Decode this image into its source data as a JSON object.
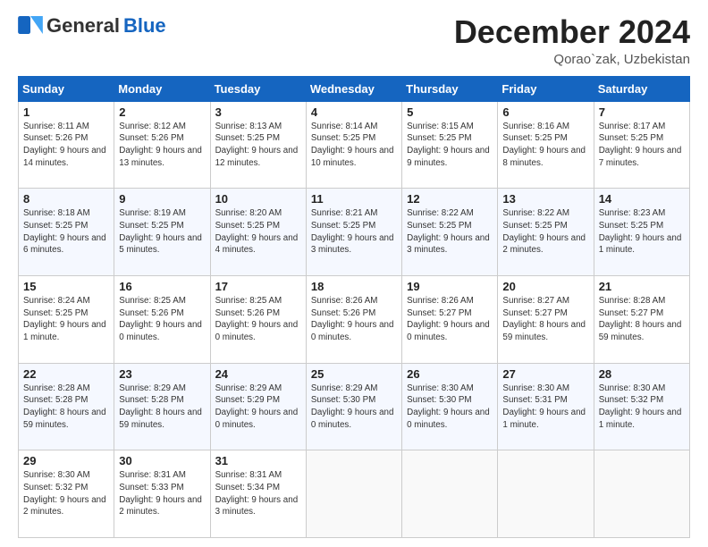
{
  "header": {
    "logo_general": "General",
    "logo_blue": "Blue",
    "month_title": "December 2024",
    "location": "Qorao`zak, Uzbekistan"
  },
  "weekdays": [
    "Sunday",
    "Monday",
    "Tuesday",
    "Wednesday",
    "Thursday",
    "Friday",
    "Saturday"
  ],
  "weeks": [
    [
      {
        "day": "1",
        "sunrise": "8:11 AM",
        "sunset": "5:26 PM",
        "daylight": "9 hours and 14 minutes."
      },
      {
        "day": "2",
        "sunrise": "8:12 AM",
        "sunset": "5:26 PM",
        "daylight": "9 hours and 13 minutes."
      },
      {
        "day": "3",
        "sunrise": "8:13 AM",
        "sunset": "5:25 PM",
        "daylight": "9 hours and 12 minutes."
      },
      {
        "day": "4",
        "sunrise": "8:14 AM",
        "sunset": "5:25 PM",
        "daylight": "9 hours and 10 minutes."
      },
      {
        "day": "5",
        "sunrise": "8:15 AM",
        "sunset": "5:25 PM",
        "daylight": "9 hours and 9 minutes."
      },
      {
        "day": "6",
        "sunrise": "8:16 AM",
        "sunset": "5:25 PM",
        "daylight": "9 hours and 8 minutes."
      },
      {
        "day": "7",
        "sunrise": "8:17 AM",
        "sunset": "5:25 PM",
        "daylight": "9 hours and 7 minutes."
      }
    ],
    [
      {
        "day": "8",
        "sunrise": "8:18 AM",
        "sunset": "5:25 PM",
        "daylight": "9 hours and 6 minutes."
      },
      {
        "day": "9",
        "sunrise": "8:19 AM",
        "sunset": "5:25 PM",
        "daylight": "9 hours and 5 minutes."
      },
      {
        "day": "10",
        "sunrise": "8:20 AM",
        "sunset": "5:25 PM",
        "daylight": "9 hours and 4 minutes."
      },
      {
        "day": "11",
        "sunrise": "8:21 AM",
        "sunset": "5:25 PM",
        "daylight": "9 hours and 3 minutes."
      },
      {
        "day": "12",
        "sunrise": "8:22 AM",
        "sunset": "5:25 PM",
        "daylight": "9 hours and 3 minutes."
      },
      {
        "day": "13",
        "sunrise": "8:22 AM",
        "sunset": "5:25 PM",
        "daylight": "9 hours and 2 minutes."
      },
      {
        "day": "14",
        "sunrise": "8:23 AM",
        "sunset": "5:25 PM",
        "daylight": "9 hours and 1 minute."
      }
    ],
    [
      {
        "day": "15",
        "sunrise": "8:24 AM",
        "sunset": "5:25 PM",
        "daylight": "9 hours and 1 minute."
      },
      {
        "day": "16",
        "sunrise": "8:25 AM",
        "sunset": "5:26 PM",
        "daylight": "9 hours and 0 minutes."
      },
      {
        "day": "17",
        "sunrise": "8:25 AM",
        "sunset": "5:26 PM",
        "daylight": "9 hours and 0 minutes."
      },
      {
        "day": "18",
        "sunrise": "8:26 AM",
        "sunset": "5:26 PM",
        "daylight": "9 hours and 0 minutes."
      },
      {
        "day": "19",
        "sunrise": "8:26 AM",
        "sunset": "5:27 PM",
        "daylight": "9 hours and 0 minutes."
      },
      {
        "day": "20",
        "sunrise": "8:27 AM",
        "sunset": "5:27 PM",
        "daylight": "8 hours and 59 minutes."
      },
      {
        "day": "21",
        "sunrise": "8:28 AM",
        "sunset": "5:27 PM",
        "daylight": "8 hours and 59 minutes."
      }
    ],
    [
      {
        "day": "22",
        "sunrise": "8:28 AM",
        "sunset": "5:28 PM",
        "daylight": "8 hours and 59 minutes."
      },
      {
        "day": "23",
        "sunrise": "8:29 AM",
        "sunset": "5:28 PM",
        "daylight": "8 hours and 59 minutes."
      },
      {
        "day": "24",
        "sunrise": "8:29 AM",
        "sunset": "5:29 PM",
        "daylight": "9 hours and 0 minutes."
      },
      {
        "day": "25",
        "sunrise": "8:29 AM",
        "sunset": "5:30 PM",
        "daylight": "9 hours and 0 minutes."
      },
      {
        "day": "26",
        "sunrise": "8:30 AM",
        "sunset": "5:30 PM",
        "daylight": "9 hours and 0 minutes."
      },
      {
        "day": "27",
        "sunrise": "8:30 AM",
        "sunset": "5:31 PM",
        "daylight": "9 hours and 1 minute."
      },
      {
        "day": "28",
        "sunrise": "8:30 AM",
        "sunset": "5:32 PM",
        "daylight": "9 hours and 1 minute."
      }
    ],
    [
      {
        "day": "29",
        "sunrise": "8:30 AM",
        "sunset": "5:32 PM",
        "daylight": "9 hours and 2 minutes."
      },
      {
        "day": "30",
        "sunrise": "8:31 AM",
        "sunset": "5:33 PM",
        "daylight": "9 hours and 2 minutes."
      },
      {
        "day": "31",
        "sunrise": "8:31 AM",
        "sunset": "5:34 PM",
        "daylight": "9 hours and 3 minutes."
      },
      null,
      null,
      null,
      null
    ]
  ],
  "labels": {
    "sunrise": "Sunrise:",
    "sunset": "Sunset:",
    "daylight": "Daylight:"
  }
}
